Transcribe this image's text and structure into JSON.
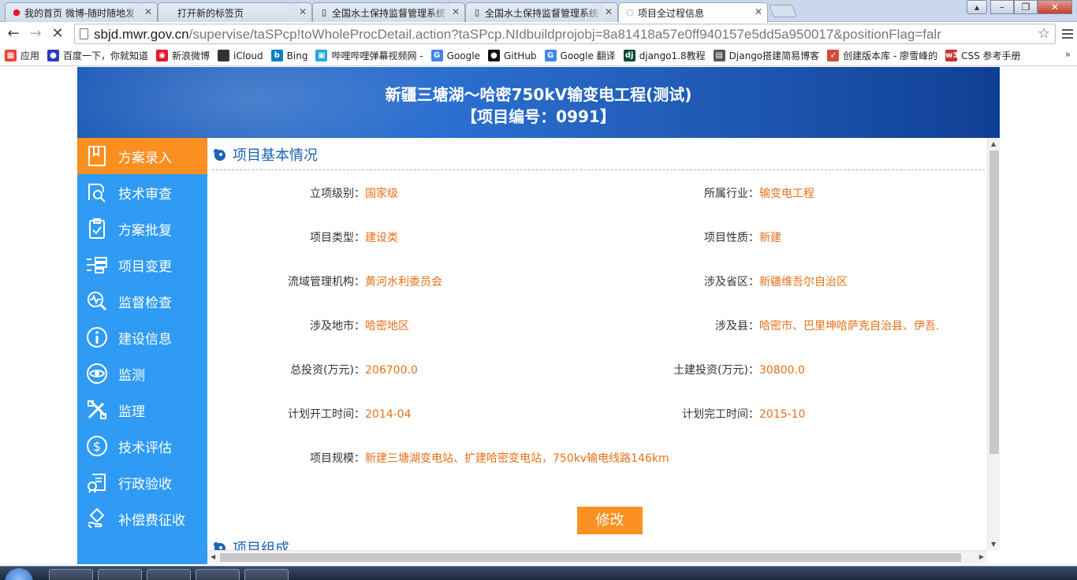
{
  "browser": {
    "tabs": [
      {
        "title": "我的首页 微博-随时随地发",
        "icon": "weibo-icon",
        "active": false
      },
      {
        "title": "打开新的标签页",
        "icon": "none",
        "active": false
      },
      {
        "title": "全国水土保持监督管理系统",
        "icon": "page-icon",
        "active": false
      },
      {
        "title": "全国水土保持监督管理系统",
        "icon": "page-icon",
        "active": false
      },
      {
        "title": "项目全过程信息",
        "icon": "loading-icon",
        "active": true
      }
    ],
    "url_host": "sbjd.mwr.gov.cn",
    "url_path": "/supervise/taSPcp!toWholeProcDetail.action?taSPcp.NIdbuildprojobj=8a81418a57e0ff940157e5dd5a950017&positionFlag=falr",
    "bookmarks": [
      {
        "label": "应用",
        "icon": "apps-icon",
        "color": "#e94335"
      },
      {
        "label": "百度一下，你就知道",
        "icon": "baidu-icon",
        "color": "#2d3cbf"
      },
      {
        "label": "新浪微博",
        "icon": "weibo-icon",
        "color": "#e6162d"
      },
      {
        "label": "iCloud",
        "icon": "apple-icon",
        "color": "#333333"
      },
      {
        "label": "Bing",
        "icon": "bing-icon",
        "color": "#0b7fc7"
      },
      {
        "label": "哔哩哔哩弹幕视频网 -",
        "icon": "bilibili-icon",
        "color": "#23a7dd"
      },
      {
        "label": "Google",
        "icon": "google-icon",
        "color": "#4285f4"
      },
      {
        "label": "GitHub",
        "icon": "github-icon",
        "color": "#111111"
      },
      {
        "label": "Google 翻译",
        "icon": "translate-icon",
        "color": "#4285f4"
      },
      {
        "label": "django1.8教程",
        "icon": "django-icon",
        "color": "#0c4b33"
      },
      {
        "label": "Django搭建简易博客",
        "icon": "book-icon",
        "color": "#555555"
      },
      {
        "label": "创建版本库 - 廖雪峰的",
        "icon": "rocket-icon",
        "color": "#d44a3a"
      },
      {
        "label": "CSS 参考手册",
        "icon": "w3-icon",
        "color": "#c7342e"
      }
    ],
    "bookmarks_more": "»"
  },
  "banner": {
    "title": "新疆三塘湖～哈密750kV输变电工程(测试)",
    "project_no": "【项目编号：0991】"
  },
  "sidebar": {
    "items": [
      {
        "label": "方案录入",
        "icon": "document-entry-icon",
        "active": true
      },
      {
        "label": "技术审查",
        "icon": "review-search-icon",
        "active": false
      },
      {
        "label": "方案批复",
        "icon": "clipboard-check-icon",
        "active": false
      },
      {
        "label": "项目变更",
        "icon": "change-icon",
        "active": false
      },
      {
        "label": "监督检查",
        "icon": "pulse-search-icon",
        "active": false
      },
      {
        "label": "建设信息",
        "icon": "info-icon",
        "active": false
      },
      {
        "label": "监测",
        "icon": "eye-icon",
        "active": false
      },
      {
        "label": "监理",
        "icon": "tools-icon",
        "active": false
      },
      {
        "label": "技术评估",
        "icon": "dollar-icon",
        "active": false
      },
      {
        "label": "行政验收",
        "icon": "acceptance-icon",
        "active": false
      },
      {
        "label": "补偿费征收",
        "icon": "hand-money-icon",
        "active": false
      }
    ]
  },
  "section_basic": {
    "title": "项目基本情况",
    "rows": [
      [
        {
          "label": "立项级别：",
          "value": "国家级"
        },
        {
          "label": "所属行业：",
          "value": "输变电工程"
        }
      ],
      [
        {
          "label": "项目类型：",
          "value": "建设类"
        },
        {
          "label": "项目性质：",
          "value": "新建"
        }
      ],
      [
        {
          "label": "流域管理机构：",
          "value": "黄河水利委员会"
        },
        {
          "label": "涉及省区：",
          "value": "新疆维吾尔自治区"
        }
      ],
      [
        {
          "label": "涉及地市：",
          "value": "哈密地区"
        },
        {
          "label": "涉及县：",
          "value": "哈密市、巴里坤哈萨克自治县、伊吾."
        }
      ],
      [
        {
          "label": "总投资(万元)：",
          "value": "206700.0"
        },
        {
          "label": "土建投资(万元)：",
          "value": "30800.0"
        }
      ],
      [
        {
          "label": "计划开工时间：",
          "value": "2014-04"
        },
        {
          "label": "计划完工时间：",
          "value": "2015-10"
        }
      ]
    ],
    "scale": {
      "label": "项目规模：",
      "value": "新建三塘湖变电站、扩建哈密变电站，750kv输电线路146km"
    },
    "edit_label": "修改"
  },
  "section_compose": {
    "title": "项目组成"
  },
  "colors": {
    "accent_orange": "#fb8f20",
    "sidebar_blue": "#2f9bf5",
    "value_orange": "#ea6f17",
    "heading_blue": "#1a63b6"
  }
}
